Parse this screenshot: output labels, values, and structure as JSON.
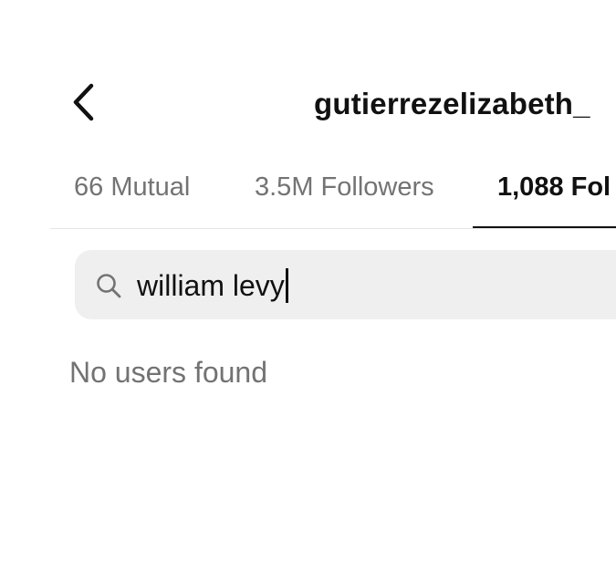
{
  "header": {
    "title": "gutierrezelizabeth_",
    "back_icon": "chevron-left-icon"
  },
  "tabs": [
    {
      "label": "66 Mutual",
      "selected": false
    },
    {
      "label": "3.5M Followers",
      "selected": false
    },
    {
      "label": "1,088 Fol",
      "selected": true
    }
  ],
  "search": {
    "icon": "search-icon",
    "value": "william levy"
  },
  "results": {
    "empty_message": "No users found"
  },
  "colors": {
    "text_primary": "#111111",
    "text_secondary": "#737373",
    "search_background": "#efefef",
    "divider": "#e6e6e6"
  }
}
